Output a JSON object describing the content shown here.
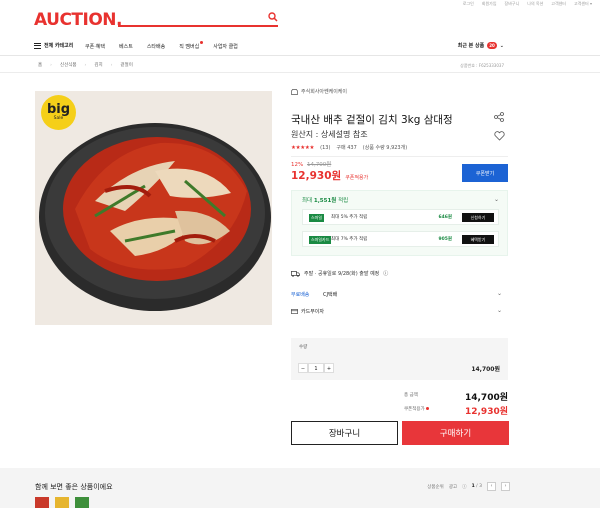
{
  "util_links": [
    "로그인",
    "회원가입",
    "장바구니",
    "나의 옥션",
    "고객센터",
    "고객센터 ▾"
  ],
  "logo": "AUCTION.",
  "search": {
    "placeholder": ""
  },
  "nav": {
    "category_label": "전체 카테고리",
    "menu": [
      "쿠폰·혜택",
      "베스트",
      "스타배송",
      "직 멤버십",
      "사업자 클럽"
    ],
    "recent_label": "최근 본 상품",
    "recent_count": "20"
  },
  "breadcrumb": [
    "홈",
    "신선식품",
    "김치",
    "겉절이"
  ],
  "product_no": "상품번호 : F625333037",
  "image": {
    "badge_big": "big",
    "badge_sale": "Sale"
  },
  "seller": "주식회사아쎈케이케이",
  "title": "국내산 배추 겉절이 김치 3kg 삼대정",
  "origin": "원산지 : 상세설명 참조",
  "rating": {
    "stars": "★★★★★",
    "reviews": "(13)",
    "purchases": "구매 437",
    "likes": "(상품 수량 9,923개)"
  },
  "price": {
    "discount": "12%",
    "original": "14,700원",
    "final": "12,930원",
    "coupon_label": "쿠폰적용가",
    "coupon_button": "쿠폰받기"
  },
  "benefit": {
    "head_prefix": "최대",
    "head_amount": "1,551원",
    "head_suffix": "적립",
    "rows": [
      {
        "tag": "스마일",
        "text": "최대 5% 추가 적립",
        "amount": "646원",
        "button": "신청하기"
      },
      {
        "tag": "스마일카드",
        "text": "최대 7% 추가 적립",
        "amount": "905원",
        "button": "혜택받기"
      }
    ]
  },
  "shipping": {
    "notice": "주말 · 공휴일로 9/28(화) 출발 예정",
    "free_label": "무료배송",
    "courier": "CJ택배",
    "card_label": "카드무이자"
  },
  "quantity": {
    "label": "수량",
    "minus": "−",
    "value": "1",
    "plus": "+",
    "price": "14,700원"
  },
  "summary": {
    "total_label": "총 금액",
    "total_value": "14,700원",
    "coupon_label": "쿠폰적용가",
    "coupon_value": "12,930원"
  },
  "actions": {
    "cart": "장바구니",
    "buy": "구매하기"
  },
  "recommend": {
    "title": "함께 보면 좋은 상품이에요",
    "sort_a": "상품순위",
    "sort_b": "광고",
    "page": "1",
    "total": "3"
  },
  "colors": {
    "brand": "#e8322f",
    "coupon_blue": "#1c63d4",
    "benefit_green": "#1a8a43",
    "buy_red": "#e8363a"
  }
}
